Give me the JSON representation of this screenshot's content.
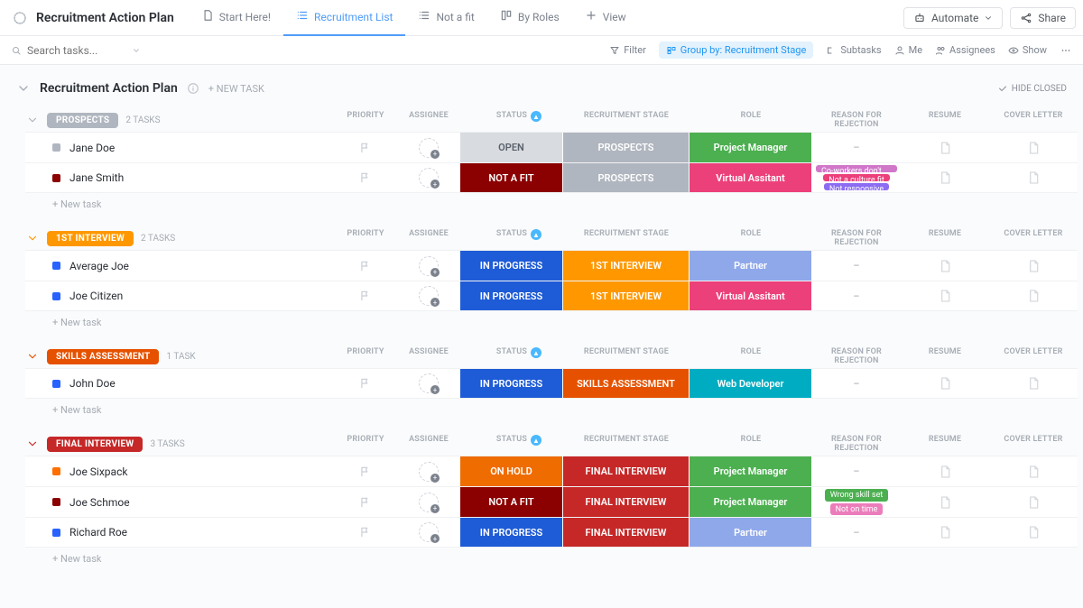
{
  "header": {
    "doc_title": "Recruitment Action Plan",
    "tabs": [
      {
        "label": "Start Here!",
        "icon": "doc"
      },
      {
        "label": "Recruitment List",
        "icon": "list",
        "active": true
      },
      {
        "label": "Not a fit",
        "icon": "list"
      },
      {
        "label": "By Roles",
        "icon": "board"
      },
      {
        "label": "View",
        "icon": "plus"
      }
    ],
    "automate": "Automate",
    "share": "Share"
  },
  "toolbar": {
    "search_placeholder": "Search tasks...",
    "filter": "Filter",
    "group_by": "Group by: Recruitment Stage",
    "subtasks": "Subtasks",
    "me": "Me",
    "assignees": "Assignees",
    "show": "Show"
  },
  "list": {
    "title": "Recruitment Action Plan",
    "new_task": "+ NEW TASK",
    "hide_closed": "HIDE CLOSED",
    "new_task_row": "+ New task",
    "columns": {
      "priority": "PRIORITY",
      "assignee": "ASSIGNEE",
      "status": "STATUS",
      "stage": "RECRUITMENT STAGE",
      "role": "ROLE",
      "reason": "REASON FOR REJECTION",
      "resume": "RESUME",
      "cover": "COVER LETTER"
    }
  },
  "groups": [
    {
      "name": "PROSPECTS",
      "color": "#b0b6bf",
      "collapse_color": "#adb3bd",
      "count": "2 TASKS",
      "rows": [
        {
          "name": "Jane Doe",
          "sq": "#b0b6bf",
          "status": "OPEN",
          "status_bg": "#d8dbe0",
          "status_fg": "#5a616b",
          "stage": "PROSPECTS",
          "stage_bg": "#b0b6bf",
          "role": "Project Manager",
          "role_bg": "#4caf50",
          "reason_text": "–",
          "tags": []
        },
        {
          "name": "Jane Smith",
          "sq": "#8b0000",
          "status": "NOT A FIT",
          "status_bg": "#8b0000",
          "stage": "PROSPECTS",
          "stage_bg": "#b0b6bf",
          "role": "Virtual Assitant",
          "role_bg": "#ec407a",
          "tags": [
            {
              "text": "Co-workers don't appro...",
              "bg": "#d177c9"
            },
            {
              "text": "Not a culture fit",
              "bg": "#ec407a"
            },
            {
              "text": "Not responsive",
              "bg": "#8c6cf2"
            }
          ]
        }
      ]
    },
    {
      "name": "1ST INTERVIEW",
      "color": "#ff9800",
      "collapse_color": "#ff9800",
      "count": "2 TASKS",
      "rows": [
        {
          "name": "Average Joe",
          "sq": "#2962ff",
          "status": "IN PROGRESS",
          "status_bg": "#1e5bd6",
          "stage": "1ST INTERVIEW",
          "stage_bg": "#ff9800",
          "role": "Partner",
          "role_bg": "#8fa8ea",
          "reason_text": "–",
          "tags": []
        },
        {
          "name": "Joe Citizen",
          "sq": "#2962ff",
          "status": "IN PROGRESS",
          "status_bg": "#1e5bd6",
          "stage": "1ST INTERVIEW",
          "stage_bg": "#ff9800",
          "role": "Virtual Assitant",
          "role_bg": "#ec407a",
          "reason_text": "–",
          "tags": []
        }
      ]
    },
    {
      "name": "SKILLS ASSESSMENT",
      "color": "#e65100",
      "collapse_color": "#e65100",
      "count": "1 TASK",
      "rows": [
        {
          "name": "John Doe",
          "sq": "#2962ff",
          "status": "IN PROGRESS",
          "status_bg": "#1e5bd6",
          "stage": "SKILLS ASSESSMENT",
          "stage_bg": "#e65100",
          "role": "Web Developer",
          "role_bg": "#00acc1",
          "reason_text": "–",
          "tags": []
        }
      ]
    },
    {
      "name": "FINAL INTERVIEW",
      "color": "#c62828",
      "collapse_color": "#c62828",
      "count": "3 TASKS",
      "rows": [
        {
          "name": "Joe Sixpack",
          "sq": "#ff6f00",
          "status": "ON HOLD",
          "status_bg": "#ef6c00",
          "stage": "FINAL INTERVIEW",
          "stage_bg": "#c62828",
          "role": "Project Manager",
          "role_bg": "#4caf50",
          "reason_text": "–",
          "tags": []
        },
        {
          "name": "Joe Schmoe",
          "sq": "#8b0000",
          "status": "NOT A FIT",
          "status_bg": "#8b0000",
          "stage": "FINAL INTERVIEW",
          "stage_bg": "#c62828",
          "role": "Project Manager",
          "role_bg": "#4caf50",
          "tags": [
            {
              "text": "Wrong skill set",
              "bg": "#4caf50"
            },
            {
              "text": "Not on time",
              "bg": "#ec7dbb"
            }
          ]
        },
        {
          "name": "Richard Roe",
          "sq": "#2962ff",
          "status": "IN PROGRESS",
          "status_bg": "#1e5bd6",
          "stage": "FINAL INTERVIEW",
          "stage_bg": "#c62828",
          "role": "Partner",
          "role_bg": "#8fa8ea",
          "reason_text": "–",
          "tags": []
        }
      ]
    }
  ]
}
